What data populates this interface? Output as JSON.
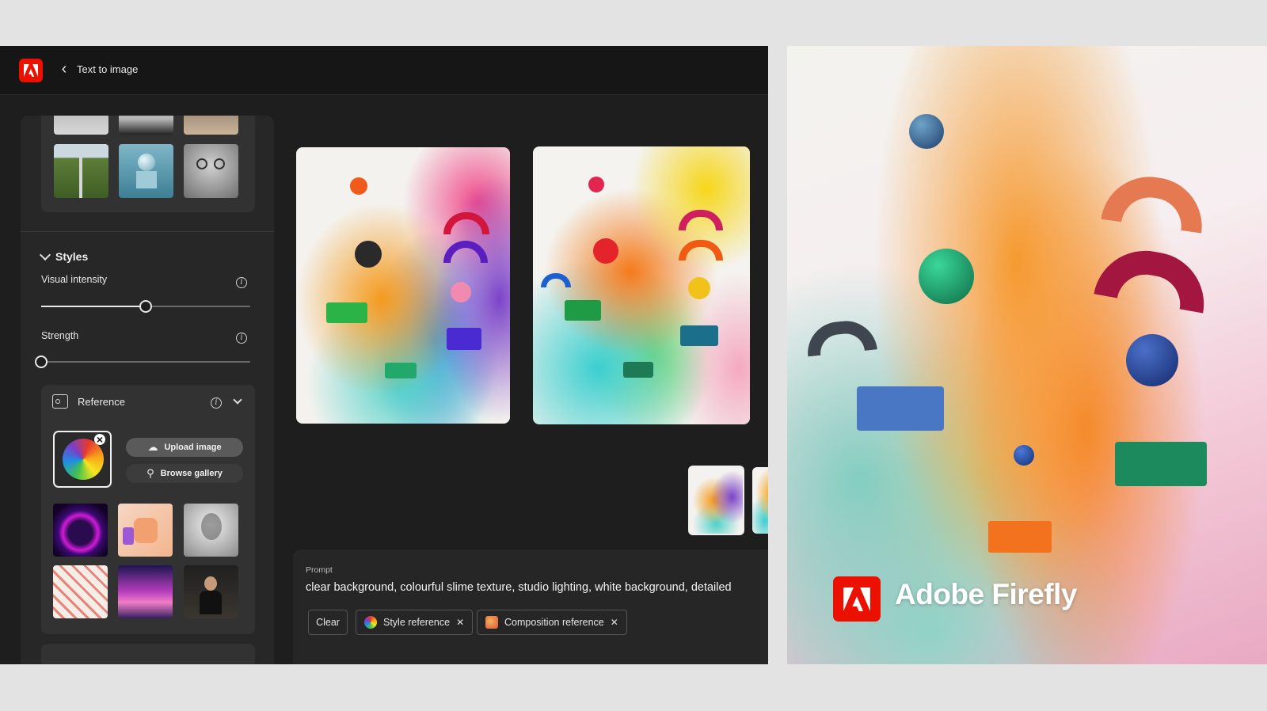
{
  "app": {
    "page_title": "Text to image",
    "brand_color": "#eb1000"
  },
  "styles": {
    "heading": "Styles",
    "visual_intensity": {
      "label": "Visual intensity",
      "value_fraction": 0.5
    },
    "strength": {
      "label": "Strength",
      "value_fraction": 0.0
    }
  },
  "reference": {
    "label": "Reference",
    "upload_label": "Upload image",
    "browse_label": "Browse gallery"
  },
  "prompt": {
    "label": "Prompt",
    "text": "clear background, colourful slime texture, studio lighting, white background, detailed",
    "clear_label": "Clear",
    "chips": [
      {
        "label": "Style reference"
      },
      {
        "label": "Composition reference"
      }
    ]
  },
  "promo": {
    "product_name": "Adobe Firefly"
  },
  "icons": [
    "adobe-logo-icon",
    "back-arrow-icon",
    "chevron-down-icon",
    "info-icon",
    "reference-icon",
    "upload-cloud-icon",
    "binoculars-icon",
    "close-icon"
  ]
}
